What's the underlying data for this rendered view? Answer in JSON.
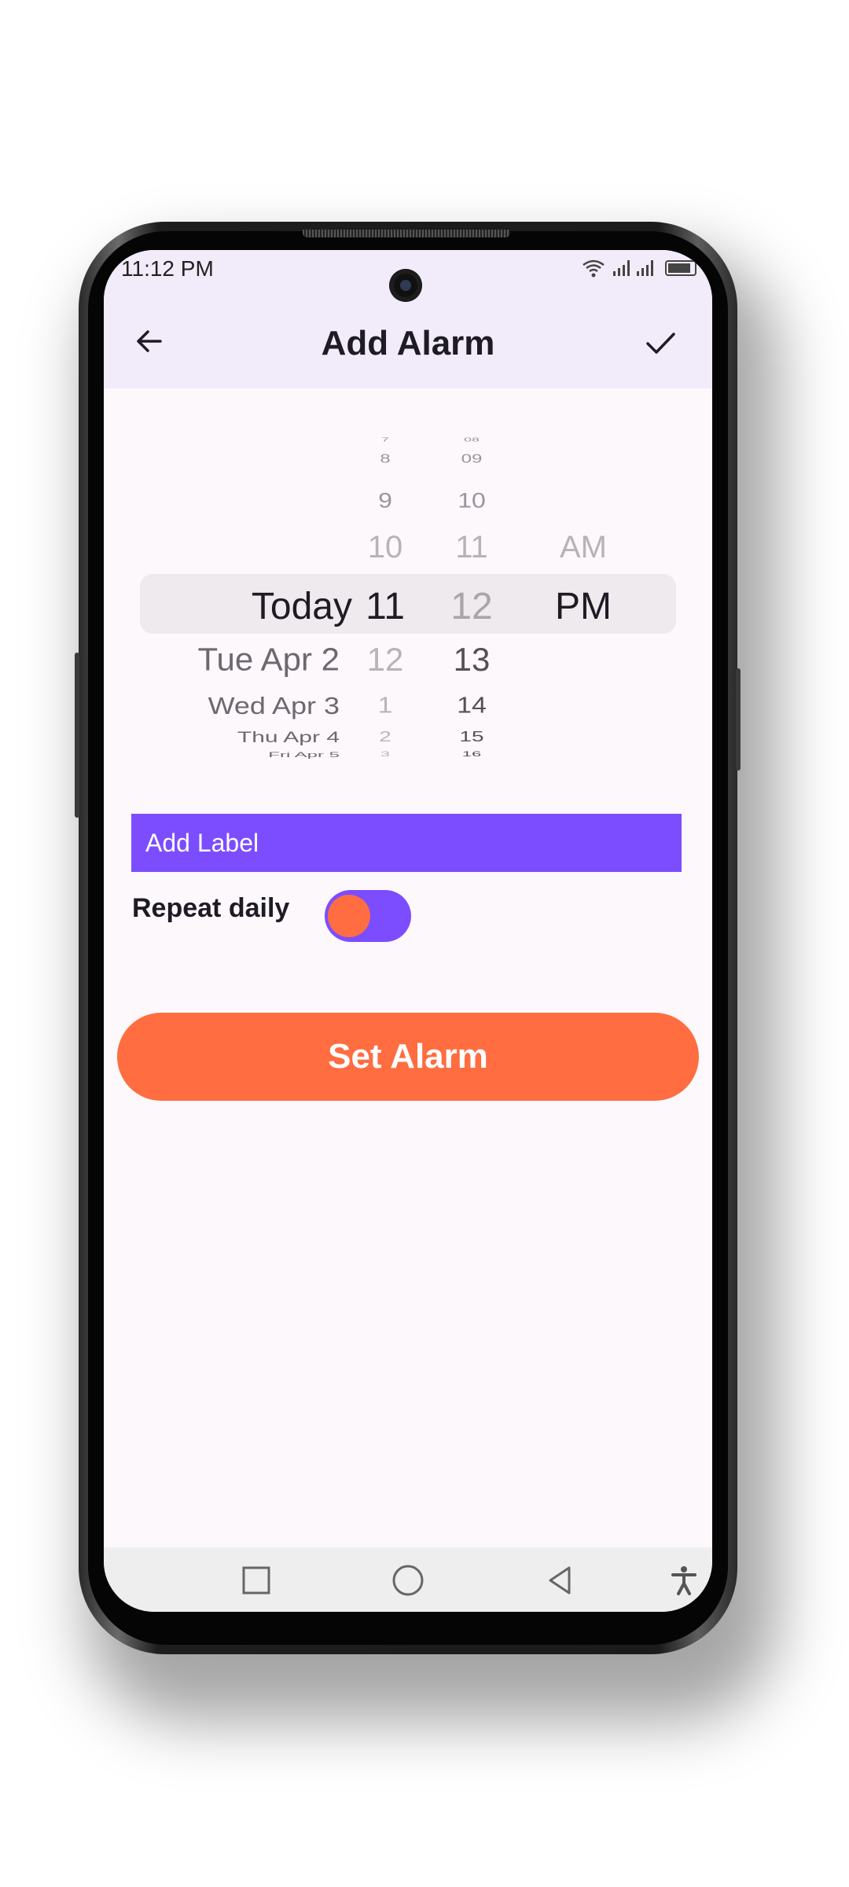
{
  "status_bar": {
    "time": "11:12 PM",
    "icons": [
      "wifi-icon",
      "signal-icon",
      "battery-icon"
    ]
  },
  "app_bar": {
    "title": "Add Alarm",
    "back_icon": "arrow-left-icon",
    "confirm_icon": "check-icon"
  },
  "time_picker": {
    "date_column": {
      "selected": "Today",
      "below": [
        "Tue Apr 2",
        "Wed Apr 3",
        "Thu Apr 4",
        "Fri Apr 5"
      ]
    },
    "hour_column": {
      "above": [
        "7",
        "8",
        "9",
        "10"
      ],
      "selected": "11",
      "below": [
        "12",
        "1",
        "2",
        "3"
      ]
    },
    "minute_column": {
      "above": [
        "08",
        "09",
        "10",
        "11"
      ],
      "selected": "12",
      "below": [
        "13",
        "14",
        "15",
        "16"
      ]
    },
    "ampm_column": {
      "above": [
        "AM"
      ],
      "selected": "PM"
    }
  },
  "label_input": {
    "placeholder": "Add Label",
    "value": ""
  },
  "repeat": {
    "label": "Repeat daily",
    "enabled": true
  },
  "set_alarm_button": {
    "label": "Set Alarm"
  },
  "colors": {
    "accent_purple": "#7c4dff",
    "accent_orange": "#ff6d40",
    "appbar_bg": "#f2ecfa",
    "screen_bg": "#fdf8fc"
  },
  "nav_bar": {
    "icons": [
      "recents-square-icon",
      "home-circle-icon",
      "back-triangle-icon",
      "accessibility-icon"
    ]
  }
}
